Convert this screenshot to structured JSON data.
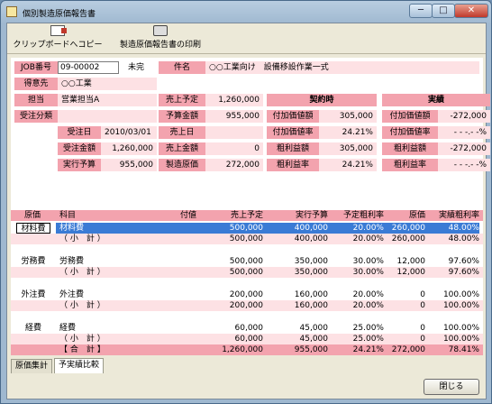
{
  "window": {
    "title": "個別製造原価報告書",
    "minimize": "─",
    "maximize": "□",
    "close": "✕"
  },
  "toolbar": {
    "copy_label": "クリップボードへコピー",
    "print_label": "製造原価報告書の印刷"
  },
  "header": {
    "job_label": "JOB番号",
    "job_value": "09-00002",
    "status": "未完",
    "item_label": "件名",
    "item_value": "○○工業向け　設備移設作業一式",
    "client_label": "得意先",
    "client_value": "○○工業",
    "staff_label": "担当",
    "staff_value": "営業担当A",
    "order_class_label": "受注分類",
    "order_date_label": "受注日",
    "order_date_value": "2010/03/01",
    "order_amount_label": "受注金額",
    "order_amount_value": "1,260,000",
    "exec_budget_label": "実行予算",
    "exec_budget_value": "955,000"
  },
  "mid": {
    "sales_plan_label": "売上予定",
    "sales_plan_value": "1,260,000",
    "budget_amount_label": "予算金額",
    "budget_amount_value": "955,000",
    "sales_date_label": "売上日",
    "sales_date_value": "",
    "sales_amount_label": "売上金額",
    "sales_amount_value": "0",
    "mfg_cost_label": "製造原価",
    "mfg_cost_value": "272,000"
  },
  "contract": {
    "header": "契約時",
    "rows": [
      {
        "label": "付加価値額",
        "value": "305,000"
      },
      {
        "label": "付加価値率",
        "value": "24.21%"
      },
      {
        "label": "粗利益額",
        "value": "305,000"
      },
      {
        "label": "粗利益率",
        "value": "24.21%"
      }
    ]
  },
  "actual": {
    "header": "実績",
    "rows": [
      {
        "label": "付加価値額",
        "value": "-272,000"
      },
      {
        "label": "付加価値率",
        "value": "- - -.- -%"
      },
      {
        "label": "粗利益額",
        "value": "-272,000"
      },
      {
        "label": "粗利益率",
        "value": "- - -.- -%"
      }
    ]
  },
  "grid": {
    "columns": [
      "原価",
      "科目",
      "付値",
      "売上予定",
      "実行予算",
      "予定粗利率",
      "原価",
      "実績粗利率"
    ],
    "rows": [
      {
        "group": "材料費",
        "subject": "材料費",
        "tag": "",
        "plan": "500,000",
        "budget": "400,000",
        "prate": "20.00%",
        "cost": "260,000",
        "arate": "48.00%"
      },
      {
        "group": "",
        "subject": "（ 小　計 ）",
        "tag": "",
        "plan": "500,000",
        "budget": "400,000",
        "prate": "20.00%",
        "cost": "260,000",
        "arate": "48.00%"
      },
      {
        "group": "労務費",
        "subject": "労務費",
        "tag": "",
        "plan": "500,000",
        "budget": "350,000",
        "prate": "30.00%",
        "cost": "12,000",
        "arate": "97.60%"
      },
      {
        "group": "",
        "subject": "（ 小　計 ）",
        "tag": "",
        "plan": "500,000",
        "budget": "350,000",
        "prate": "30.00%",
        "cost": "12,000",
        "arate": "97.60%"
      },
      {
        "group": "外注費",
        "subject": "外注費",
        "tag": "",
        "plan": "200,000",
        "budget": "160,000",
        "prate": "20.00%",
        "cost": "0",
        "arate": "100.00%"
      },
      {
        "group": "",
        "subject": "（ 小　計 ）",
        "tag": "",
        "plan": "200,000",
        "budget": "160,000",
        "prate": "20.00%",
        "cost": "0",
        "arate": "100.00%"
      },
      {
        "group": "経費",
        "subject": "経費",
        "tag": "",
        "plan": "60,000",
        "budget": "45,000",
        "prate": "25.00%",
        "cost": "0",
        "arate": "100.00%"
      },
      {
        "group": "",
        "subject": "（ 小　計 ）",
        "tag": "",
        "plan": "60,000",
        "budget": "45,000",
        "prate": "25.00%",
        "cost": "0",
        "arate": "100.00%"
      }
    ],
    "total": {
      "subject": "【 合　計 】",
      "plan": "1,260,000",
      "budget": "955,000",
      "prate": "24.21%",
      "cost": "272,000",
      "arate": "78.41%"
    }
  },
  "tabs": [
    "原価集計",
    "予実績比較"
  ],
  "close_button": "閉じる"
}
